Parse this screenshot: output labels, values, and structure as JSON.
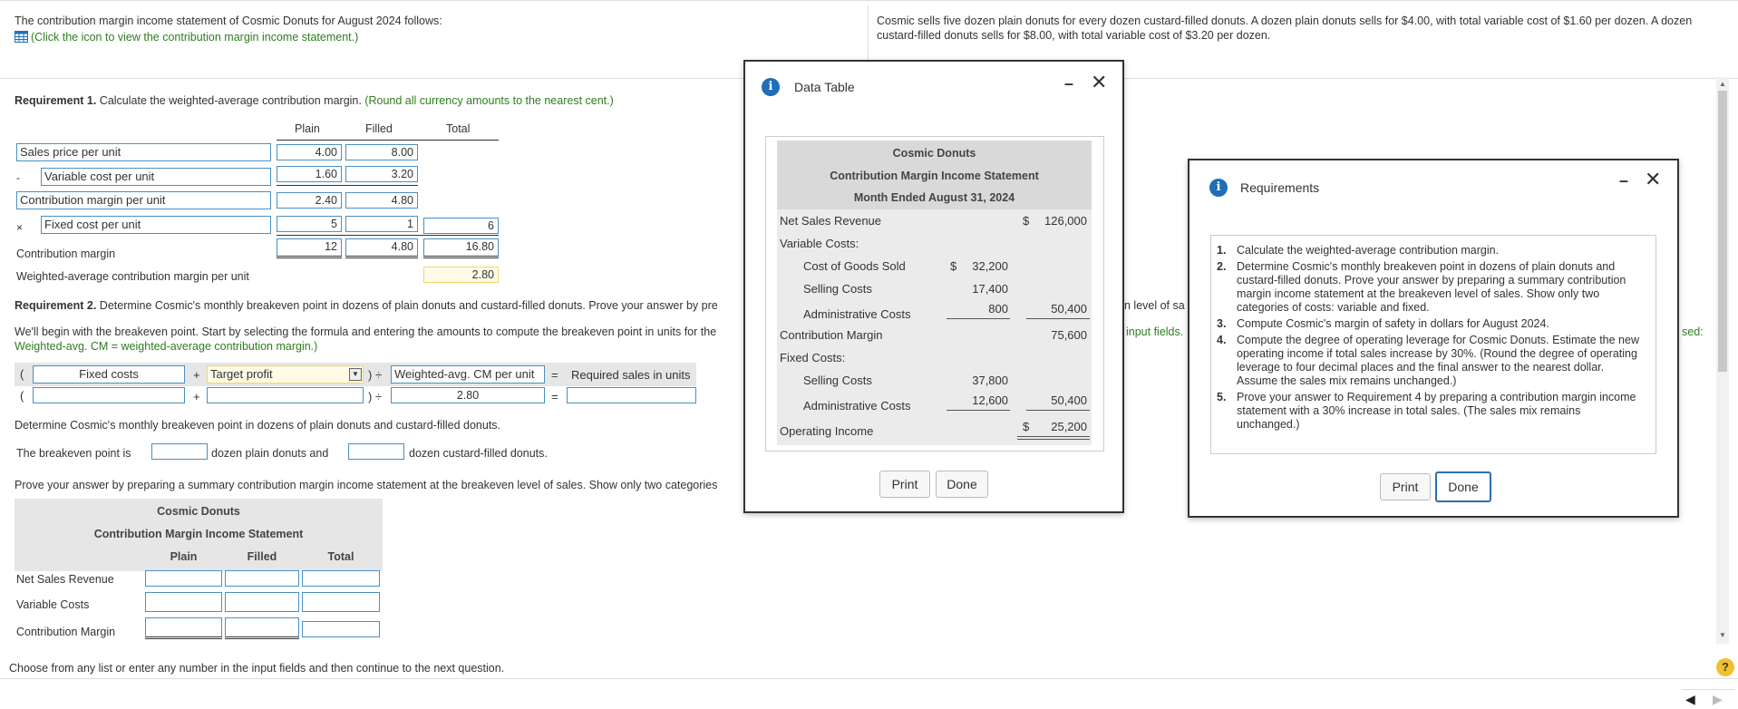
{
  "top": {
    "intro": "The contribution margin income statement of Cosmic Donuts for August 2024 follows:",
    "click_link": "(Click the icon to view the contribution margin income statement.)",
    "right_text": "Cosmic sells five dozen plain donuts for every dozen custard-filled donuts. A dozen plain donuts sells for $4.00, with total variable cost of $1.60 per dozen. A dozen custard-filled donuts sells for $8.00, with total variable cost of $3.20 per dozen."
  },
  "req1": {
    "title_bold": "Requirement 1.",
    "title_rest": " Calculate the weighted-average contribution margin.",
    "hint": "(Round all currency amounts to the nearest cent.)",
    "col_plain": "Plain",
    "col_filled": "Filled",
    "col_total": "Total",
    "rows": {
      "sales_label": "Sales price per unit",
      "sales_plain": "4.00",
      "sales_filled": "8.00",
      "minus": "-",
      "var_label": "Variable cost per unit",
      "var_plain": "1.60",
      "var_filled": "3.20",
      "cm_label": "Contribution margin per unit",
      "cm_plain": "2.40",
      "cm_filled": "4.80",
      "times": "×",
      "fixed_label": "Fixed cost per unit",
      "fixed_plain": "5",
      "fixed_filled": "1",
      "fixed_total": "6",
      "contrib_label": "Contribution margin",
      "contrib_plain": "12",
      "contrib_filled": "4.80",
      "contrib_total": "16.80",
      "wacm_label": "Weighted-average contribution margin per unit",
      "wacm_value": "2.80"
    }
  },
  "req2": {
    "title_bold": "Requirement 2.",
    "title_rest": " Determine Cosmic's monthly breakeven point in dozens of plain donuts and custard-filled donuts. Prove your answer by pre",
    "begin_text": "We'll begin with the breakeven point. Start by selecting the formula and entering the amounts to compute the breakeven point in units for the",
    "begin_green": "Weighted-avg. CM = weighted-average contribution margin.)",
    "formula": {
      "open1": "(",
      "fixed_costs": "Fixed costs",
      "plus": "+",
      "target_profit": "Target profit",
      "close_div": ") ÷",
      "wacm": "Weighted-avg. CM per unit",
      "equals": "=",
      "required": "Required sales in units",
      "open2": "(",
      "row2_wacm": "2.80"
    },
    "determine": "Determine Cosmic's monthly breakeven point in dozens of plain donuts and custard-filled donuts.",
    "breakeven_pre": "The breakeven point is",
    "breakeven_mid": "dozen plain donuts and",
    "breakeven_post": "dozen custard-filled donuts.",
    "prove": "Prove your answer by preparing a summary contribution margin income statement at the breakeven level of sales. Show only two categories",
    "stmt": {
      "company": "Cosmic Donuts",
      "title": "Contribution Margin Income Statement",
      "col_plain": "Plain",
      "col_filled": "Filled",
      "col_total": "Total",
      "r1": "Net Sales Revenue",
      "r2": "Variable Costs",
      "r3": "Contribution Margin"
    },
    "behind1": "n level of sa",
    "behind2": "input fields.",
    "behind3": "sed:"
  },
  "footer": {
    "text": "Choose from any list or enter any number in the input fields and then continue to the next question.",
    "help": "?"
  },
  "data_table": {
    "title": "Data Table",
    "company": "Cosmic Donuts",
    "statement": "Contribution Margin Income Statement",
    "period": "Month Ended August 31, 2024",
    "net_sales": "Net Sales Revenue",
    "dollar": "$",
    "net_sales_val": "126,000",
    "var_costs": "Variable Costs:",
    "cogs": "Cost of Goods Sold",
    "cogs_val": "32,200",
    "selling": "Selling Costs",
    "selling_val": "17,400",
    "admin": "Administrative Costs",
    "admin_val": "800",
    "var_total": "50,400",
    "cm": "Contribution Margin",
    "cm_val": "75,600",
    "fixed": "Fixed Costs:",
    "f_selling": "Selling Costs",
    "f_selling_val": "37,800",
    "f_admin": "Administrative Costs",
    "f_admin_val": "12,600",
    "f_total": "50,400",
    "op_income": "Operating Income",
    "op_income_val": "25,200",
    "print": "Print",
    "done": "Done"
  },
  "requirements": {
    "title": "Requirements",
    "items": [
      "Calculate the weighted-average contribution margin.",
      "Determine Cosmic's monthly breakeven point in dozens of plain donuts and custard-filled donuts. Prove your answer by preparing a summary contribution margin income statement at the breakeven level of sales. Show only two categories of costs: variable and fixed.",
      "Compute Cosmic's margin of safety in dollars for August 2024.",
      "Compute the degree of operating leverage for Cosmic Donuts. Estimate the new operating income if total sales increase by 30%. (Round the degree of operating leverage to four decimal places and the final answer to the nearest dollar. Assume the sales mix remains unchanged.)",
      "Prove your answer to Requirement 4 by preparing a contribution margin income statement with a 30% increase in total sales. (The sales mix remains unchanged.)"
    ],
    "nums": [
      "1.",
      "2.",
      "3.",
      "4.",
      "5."
    ],
    "print": "Print",
    "done": "Done"
  },
  "icons": {
    "info": "i",
    "minimize": "–",
    "close": "✕"
  }
}
